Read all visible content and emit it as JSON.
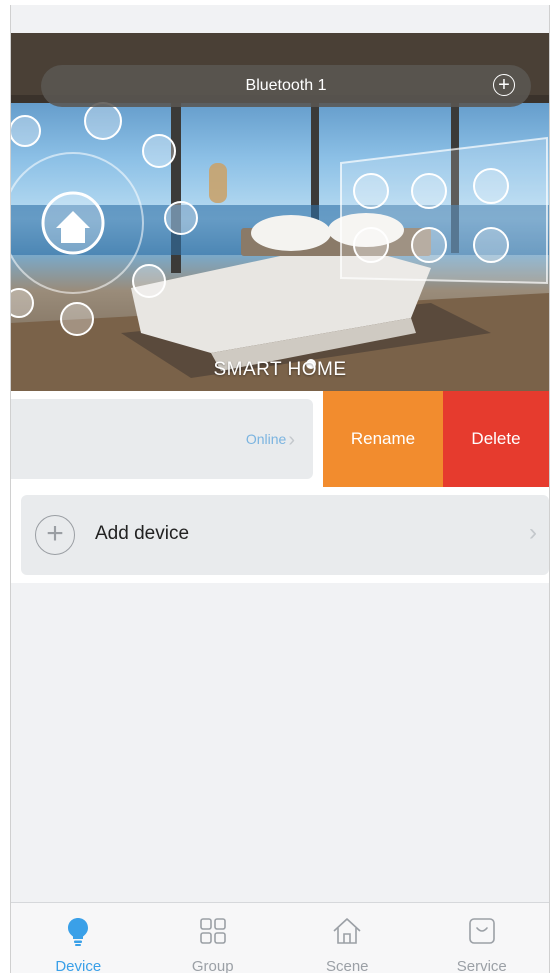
{
  "header": {
    "title": "Bluetooth 1",
    "add_icon": "plus-circle-icon"
  },
  "banner": {
    "caption": "SMART HOME"
  },
  "device_row": {
    "status": "Online",
    "chevron": "›",
    "rename_label": "Rename",
    "delete_label": "Delete",
    "colors": {
      "rename": "#f28c2e",
      "delete": "#e63b2e",
      "status": "#7bb4e0"
    }
  },
  "add_device": {
    "plus": "+",
    "label": "Add device",
    "chevron": "›"
  },
  "tabbar": {
    "active_color": "#3aa0e8",
    "tabs": [
      {
        "label": "Device",
        "icon": "bulb-icon",
        "active": true
      },
      {
        "label": "Group",
        "icon": "grid-icon",
        "active": false
      },
      {
        "label": "Scene",
        "icon": "home-icon",
        "active": false
      },
      {
        "label": "Service",
        "icon": "service-icon",
        "active": false
      }
    ]
  }
}
